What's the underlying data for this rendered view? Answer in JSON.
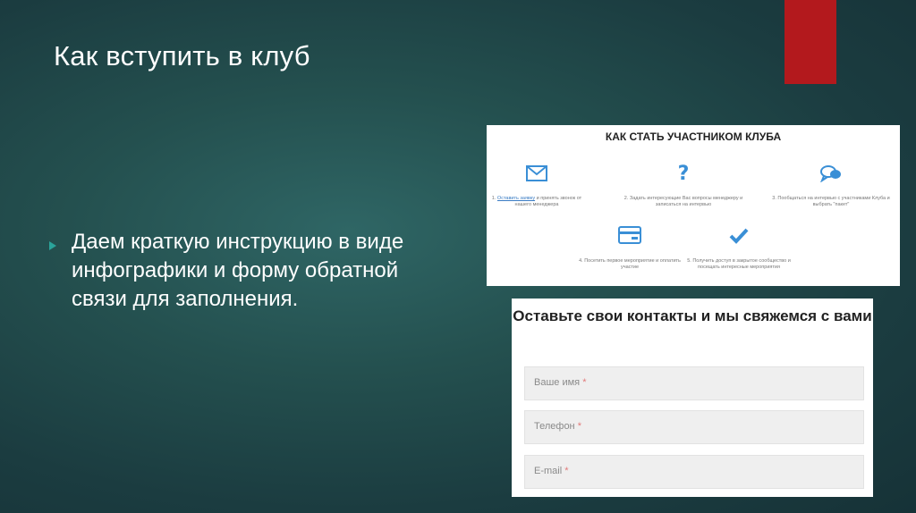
{
  "slide": {
    "title": "Как вступить в клуб",
    "body": "Даем краткую инструкцию в виде инфографики и форму обратной связи для заполнения."
  },
  "infographic": {
    "title": "КАК СТАТЬ УЧАСТНИКОМ КЛУБА",
    "steps": [
      {
        "number": "1.",
        "link": "Оставить заявку",
        "text": "и принять звонок от нашего менеджера",
        "icon": "envelope-icon"
      },
      {
        "number": "2.",
        "text": "Задать интересующие Вас вопросы менеджеру и записаться на интервью",
        "icon": "question-icon"
      },
      {
        "number": "3.",
        "text": "Пообщаться на интервью с участниками Клуба и выбрать \"пакет\"",
        "icon": "chat-icon"
      },
      {
        "number": "4.",
        "text": "Посетить первое мероприятие и оплатить участие",
        "icon": "card-icon"
      },
      {
        "number": "5.",
        "text": "Получить доступ в закрытое сообщество и посещать интересные мероприятия",
        "icon": "checkmark-icon"
      }
    ]
  },
  "form": {
    "title": "Оставьте свои контакты и мы свяжемся с вами",
    "name_placeholder": "Ваше имя",
    "phone_placeholder": "Телефон",
    "email_placeholder": "E-mail",
    "required_mark": "*"
  },
  "colors": {
    "accent_bar": "#b3191d",
    "icon_blue": "#3a8fd6"
  }
}
